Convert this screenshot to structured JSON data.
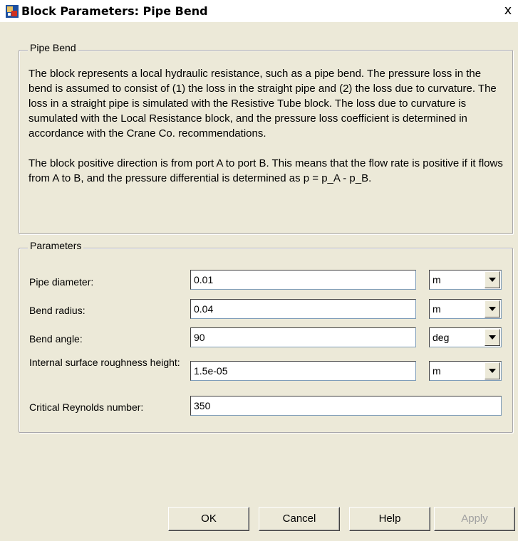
{
  "window": {
    "title": "Block Parameters: Pipe Bend",
    "close_glyph": "x"
  },
  "description_group": {
    "title": "Pipe Bend",
    "paragraph1": "The block represents a local hydraulic resistance, such as a pipe bend. The pressure loss in the bend is assumed to consist of (1) the loss in the straight pipe and (2) the loss due to curvature. The loss in a straight pipe is simulated with the Resistive Tube block. The loss due to curvature is sumulated with the Local Resistance block, and the pressure loss coefficient is determined in accordance with the Crane Co. recommendations.",
    "paragraph2": "The block positive direction is from port A to port B. This means that the flow rate is positive if it flows from A to B, and the pressure differential is determined as p = p_A - p_B."
  },
  "parameters_group": {
    "title": "Parameters",
    "rows": [
      {
        "label": "Pipe diameter:",
        "value": "0.01",
        "unit": "m"
      },
      {
        "label": "Bend radius:",
        "value": "0.04",
        "unit": "m"
      },
      {
        "label": "Bend angle:",
        "value": "90",
        "unit": "deg"
      },
      {
        "label": "Internal surface roughness height:",
        "value": "1.5e-05",
        "unit": "m"
      },
      {
        "label": "Critical Reynolds number:",
        "value": "350"
      }
    ]
  },
  "buttons": {
    "ok": "OK",
    "cancel": "Cancel",
    "help": "Help",
    "apply": "Apply"
  },
  "icons": {
    "app": "simulink-block-icon",
    "dropdown": "chevron-down-icon"
  },
  "colors": {
    "dialog_bg": "#ece9d8",
    "group_border": "#a7a6aa",
    "disabled_text": "#a0a0a0"
  }
}
